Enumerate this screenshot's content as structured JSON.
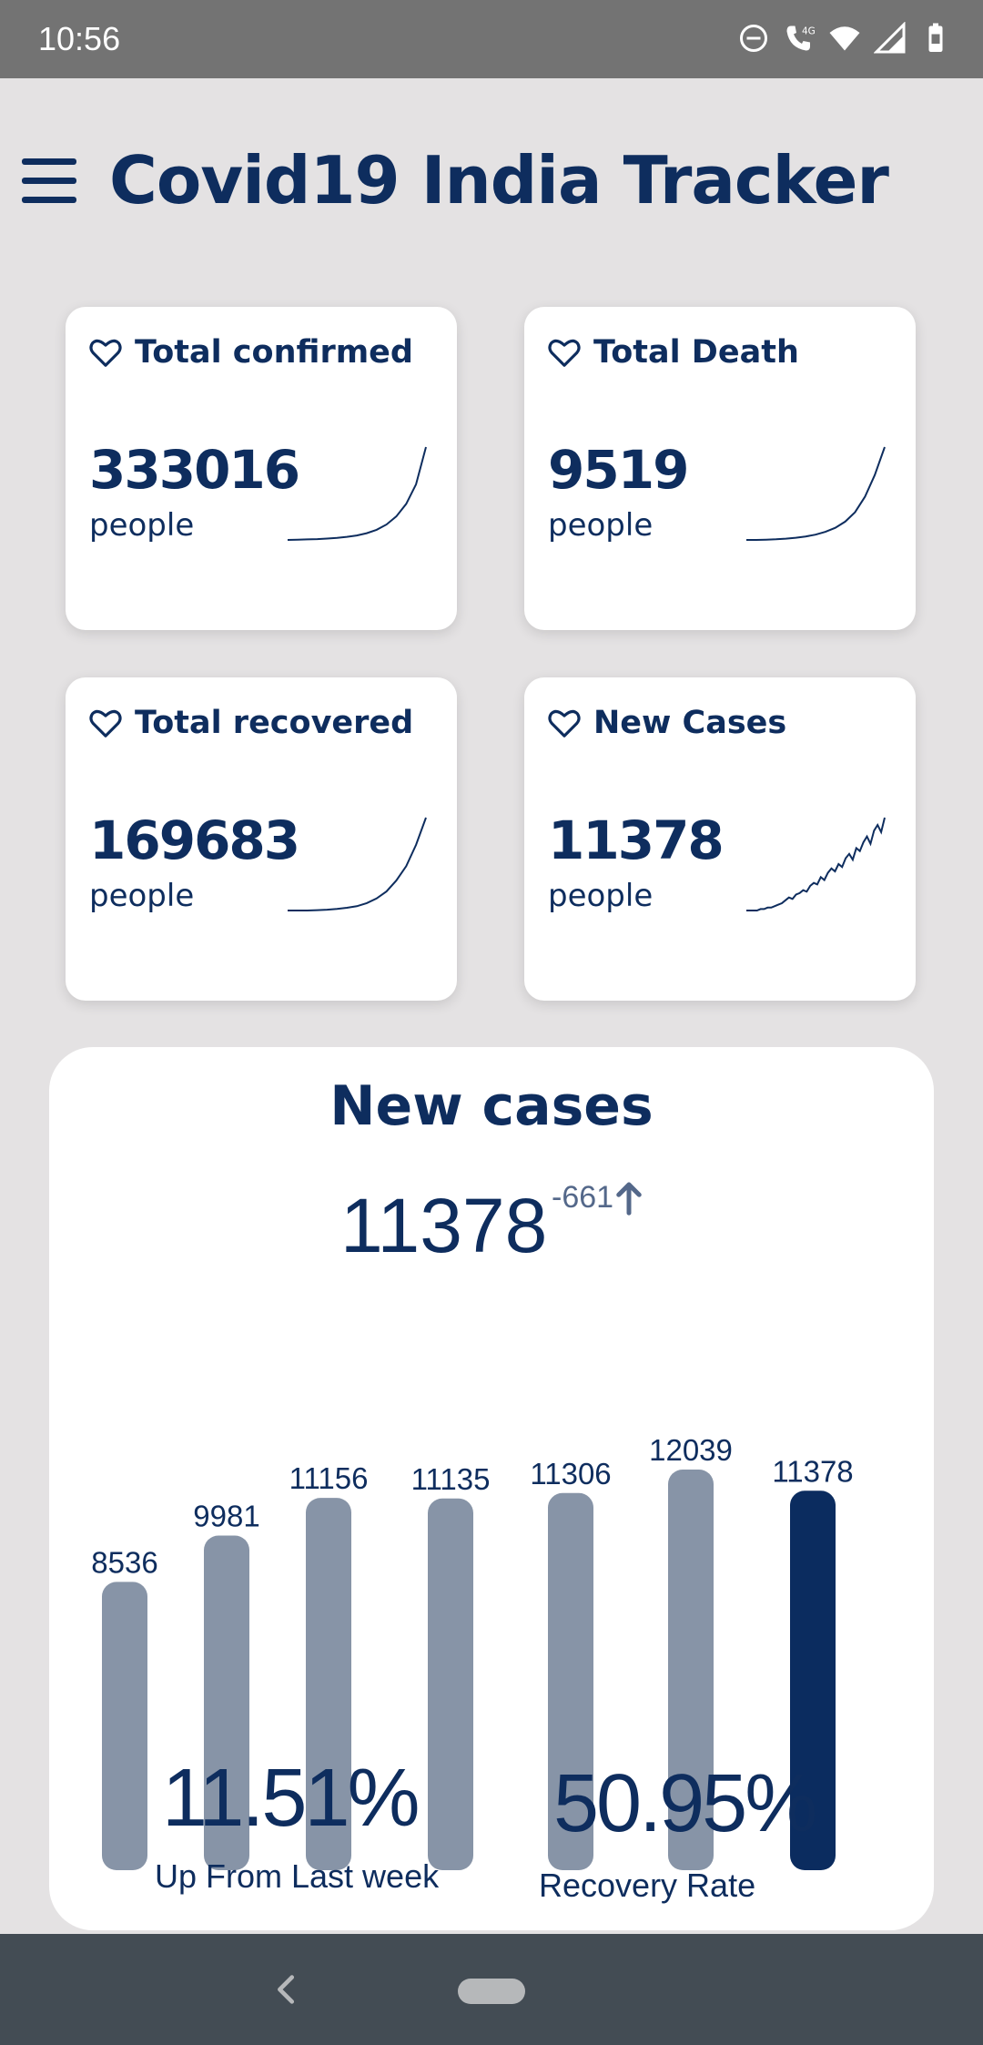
{
  "status_bar": {
    "time": "10:56",
    "network": "4G"
  },
  "header": {
    "title": "Covid19 India Tracker"
  },
  "cards": [
    {
      "title": "Total confirmed",
      "value": "333016",
      "unit": "people",
      "sparkline": [
        1,
        2,
        3,
        4,
        6,
        8,
        12,
        17,
        25,
        37,
        56,
        85,
        130,
        200,
        333
      ]
    },
    {
      "title": "Total Death",
      "value": "9519",
      "unit": "people",
      "sparkline": [
        1,
        1,
        2,
        3,
        5,
        8,
        12,
        18,
        27,
        40,
        60,
        90,
        140,
        210,
        300
      ]
    },
    {
      "title": "Total recovered",
      "value": "169683",
      "unit": "people",
      "sparkline": [
        1,
        1,
        1,
        2,
        3,
        5,
        8,
        12,
        20,
        32,
        50,
        78,
        115,
        170,
        240
      ]
    },
    {
      "title": "New Cases",
      "value": "11378",
      "unit": "people",
      "sparkline": [
        1,
        1,
        1,
        1,
        2,
        2,
        3,
        3,
        4,
        5,
        6,
        8,
        10,
        9,
        12,
        13,
        15,
        14,
        18,
        20,
        19,
        24,
        22,
        27,
        30,
        28,
        33,
        31,
        37,
        40,
        36,
        44,
        42,
        48,
        52,
        47,
        56,
        60,
        55,
        65
      ]
    }
  ],
  "new_cases_panel": {
    "title": "New cases",
    "value": "11378",
    "delta": "-661",
    "stats": [
      {
        "value": "11.51%",
        "label": "Up From Last week"
      },
      {
        "value": "50.95%",
        "label": "Recovery Rate"
      }
    ]
  },
  "chart_data": {
    "type": "bar",
    "categories": [
      "",
      "",
      "",
      "",
      "",
      "",
      ""
    ],
    "values": [
      8536,
      9981,
      11156,
      11135,
      11306,
      12039,
      11378
    ],
    "value_labels": [
      "8536",
      "9981",
      "11156",
      "11135",
      "11306",
      "12039",
      "11378"
    ],
    "highlight_index": 6,
    "colors": {
      "bar": "#8794a7",
      "highlight": "#0b2c5f"
    }
  },
  "colors": {
    "primary": "#0e2d5e",
    "background": "#e4e2e3",
    "card": "#ffffff",
    "bar": "#8794a7",
    "bar_highlight": "#0b2c5f"
  }
}
